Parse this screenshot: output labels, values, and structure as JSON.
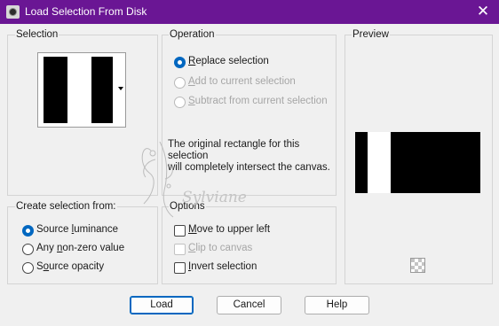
{
  "window": {
    "title": "Load Selection From Disk",
    "close_glyph": "✕"
  },
  "selection_group": {
    "label": "Selection"
  },
  "operation_group": {
    "label": "Operation",
    "options": [
      {
        "prefix": "",
        "ul": "R",
        "rest": "eplace selection",
        "checked": true,
        "enabled": true
      },
      {
        "prefix": "",
        "ul": "A",
        "rest": "dd to current selection",
        "checked": false,
        "enabled": false
      },
      {
        "prefix": "",
        "ul": "S",
        "rest": "ubtract from current selection",
        "checked": false,
        "enabled": false
      }
    ],
    "note_line1": "The original rectangle for this selection",
    "note_line2": "will completely intersect the canvas."
  },
  "preview_group": {
    "label": "Preview",
    "background_icon": "transparency-checker-icon"
  },
  "create_group": {
    "label": "Create selection from:",
    "options": [
      {
        "prefix": "Source ",
        "ul": "l",
        "rest": "uminance",
        "checked": true
      },
      {
        "prefix": "Any ",
        "ul": "n",
        "rest": "on-zero value",
        "checked": false
      },
      {
        "prefix": "S",
        "ul": "o",
        "rest": "urce opacity",
        "checked": false
      }
    ]
  },
  "options_group": {
    "label": "Options",
    "move": {
      "prefix": "",
      "ul": "M",
      "rest": "ove to upper left",
      "checked": false,
      "enabled": true
    },
    "clip": {
      "prefix": "",
      "ul": "C",
      "rest": "lip to canvas",
      "checked": false,
      "enabled": false
    },
    "invert": {
      "prefix": "",
      "ul": "I",
      "rest": "nvert selection",
      "checked": false,
      "enabled": true
    }
  },
  "buttons": {
    "load": "Load",
    "cancel": "Cancel",
    "help": "Help"
  },
  "watermark": {
    "text": "Sylviane"
  },
  "colors": {
    "titlebar": "#6a1694",
    "accent": "#0067c0",
    "dialog_bg": "#f0f0f0"
  }
}
